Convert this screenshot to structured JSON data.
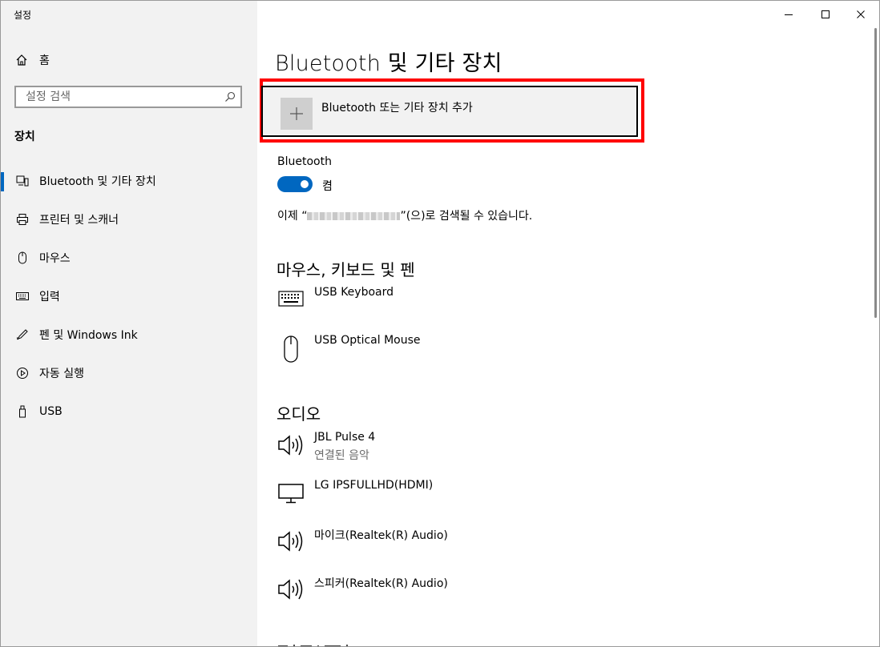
{
  "window": {
    "title": "설정"
  },
  "sidebar": {
    "home_label": "홈",
    "search_placeholder": "설정 검색",
    "section_title": "장치",
    "items": [
      {
        "label": "Bluetooth 및 기타 장치",
        "icon": "bluetooth-devices-icon",
        "active": true
      },
      {
        "label": "프린터 및 스캐너",
        "icon": "printer-icon"
      },
      {
        "label": "마우스",
        "icon": "mouse-icon"
      },
      {
        "label": "입력",
        "icon": "keyboard-icon"
      },
      {
        "label": "펜 및 Windows Ink",
        "icon": "pen-icon"
      },
      {
        "label": "자동 실행",
        "icon": "autoplay-icon"
      },
      {
        "label": "USB",
        "icon": "usb-icon"
      }
    ]
  },
  "main": {
    "title": "Bluetooth 및 기타 장치",
    "add_device_label": "Bluetooth 또는 기타 장치 추가",
    "bluetooth_label": "Bluetooth",
    "bluetooth_state": "켬",
    "bluetooth_on": true,
    "discover_prefix": "이제 “",
    "discover_suffix": "”(으)로 검색될 수 있습니다.",
    "groups": [
      {
        "title": "마우스, 키보드 및 펜",
        "devices": [
          {
            "name": "USB Keyboard",
            "icon": "keyboard-icon"
          },
          {
            "name": "USB Optical Mouse",
            "icon": "mouse-icon"
          }
        ]
      },
      {
        "title": "오디오",
        "devices": [
          {
            "name": "JBL Pulse 4",
            "status": "연결된 음악",
            "icon": "speaker-icon"
          },
          {
            "name": "LG IPSFULLHD(HDMI)",
            "icon": "monitor-icon"
          },
          {
            "name": "마이크(Realtek(R) Audio)",
            "icon": "speaker-icon"
          },
          {
            "name": "스피커(Realtek(R) Audio)",
            "icon": "speaker-icon"
          }
        ]
      }
    ]
  },
  "colors": {
    "accent": "#0067c0",
    "highlight": "#ff0000",
    "sidebar_bg": "#f2f2f2"
  }
}
